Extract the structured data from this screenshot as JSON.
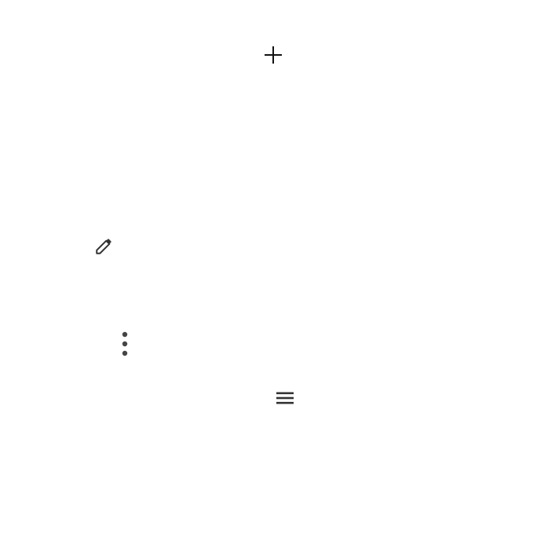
{
  "icons": {
    "add": {
      "name": "plus-icon",
      "color": "#111111"
    },
    "edit": {
      "name": "pencil-icon",
      "color": "#333333"
    },
    "more": {
      "name": "more-vert-icon",
      "color": "#444444"
    },
    "menu": {
      "name": "hamburger-menu-icon",
      "color": "#333333"
    }
  },
  "colors": {
    "background": "#ffffff"
  }
}
